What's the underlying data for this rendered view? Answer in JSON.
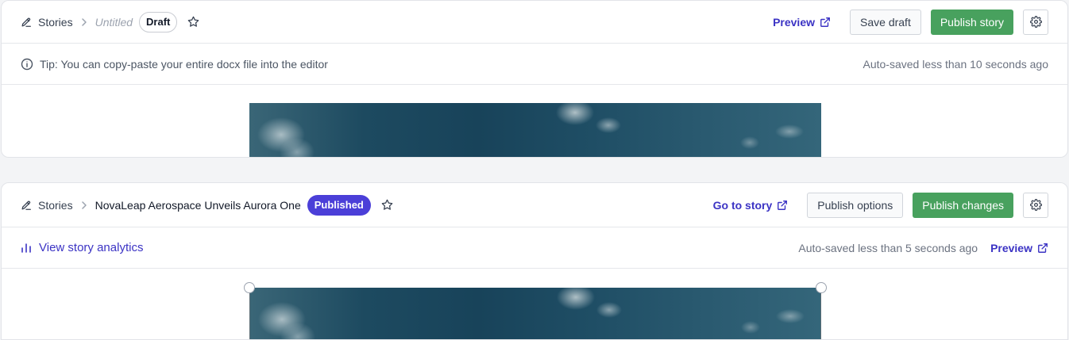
{
  "draft_panel": {
    "breadcrumb_root": "Stories",
    "story_title": "Untitled",
    "status_badge": "Draft",
    "preview_label": "Preview",
    "save_draft_label": "Save draft",
    "publish_label": "Publish story",
    "tip_text": "Tip: You can copy-paste your entire docx file into the editor",
    "autosave_text": "Auto-saved less than 10 seconds ago"
  },
  "published_panel": {
    "breadcrumb_root": "Stories",
    "story_title": "NovaLeap Aerospace Unveils Aurora One",
    "status_badge": "Published",
    "go_to_story_label": "Go to story",
    "publish_options_label": "Publish options",
    "publish_changes_label": "Publish changes",
    "analytics_label": "View story analytics",
    "autosave_text": "Auto-saved less than 5 seconds ago",
    "preview_label": "Preview"
  },
  "colors": {
    "accent_link": "#3b33c4",
    "published_badge": "#4b3fd8",
    "publish_button": "#48a15e"
  },
  "icons": [
    "edit-pencil-icon",
    "chevron-right-icon",
    "star-icon",
    "external-link-icon",
    "gear-icon",
    "info-icon",
    "bar-chart-icon"
  ]
}
